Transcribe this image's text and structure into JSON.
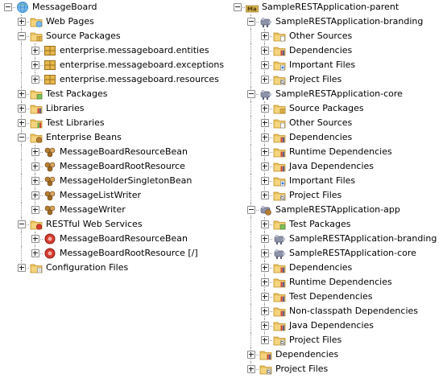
{
  "left_tree": [
    {
      "level": 0,
      "label": "MessageBoard",
      "icon": "web-project-icon",
      "toggle": "minus",
      "bar": [],
      "last": true
    },
    {
      "level": 1,
      "label": "Web Pages",
      "icon": "web-pages-folder-icon",
      "toggle": "plus",
      "bar": [],
      "last": false
    },
    {
      "level": 1,
      "label": "Source Packages",
      "icon": "source-packages-folder-icon",
      "toggle": "minus",
      "bar": [],
      "last": false
    },
    {
      "level": 2,
      "label": "enterprise.messageboard.entities",
      "icon": "package-icon",
      "toggle": "plus",
      "bar": [
        1
      ],
      "last": false
    },
    {
      "level": 2,
      "label": "enterprise.messageboard.exceptions",
      "icon": "package-icon",
      "toggle": "plus",
      "bar": [
        1
      ],
      "last": false
    },
    {
      "level": 2,
      "label": "enterprise.messageboard.resources",
      "icon": "package-icon",
      "toggle": "plus",
      "bar": [
        1
      ],
      "last": true
    },
    {
      "level": 1,
      "label": "Test Packages",
      "icon": "test-packages-folder-icon",
      "toggle": "plus",
      "bar": [],
      "last": false
    },
    {
      "level": 1,
      "label": "Libraries",
      "icon": "libraries-folder-icon",
      "toggle": "plus",
      "bar": [],
      "last": false
    },
    {
      "level": 1,
      "label": "Test Libraries",
      "icon": "test-libraries-folder-icon",
      "toggle": "plus",
      "bar": [],
      "last": false
    },
    {
      "level": 1,
      "label": "Enterprise Beans",
      "icon": "enterprise-beans-folder-icon",
      "toggle": "minus",
      "bar": [],
      "last": false
    },
    {
      "level": 2,
      "label": "MessageBoardResourceBean",
      "icon": "enterprise-bean-icon",
      "toggle": "plus",
      "bar": [
        1
      ],
      "last": false
    },
    {
      "level": 2,
      "label": "MessageBoardRootResource",
      "icon": "enterprise-bean-icon",
      "toggle": "plus",
      "bar": [
        1
      ],
      "last": false
    },
    {
      "level": 2,
      "label": "MessageHolderSingletonBean",
      "icon": "enterprise-bean-icon",
      "toggle": "plus",
      "bar": [
        1
      ],
      "last": false
    },
    {
      "level": 2,
      "label": "MessageListWriter",
      "icon": "enterprise-bean-icon",
      "toggle": "plus",
      "bar": [
        1
      ],
      "last": false
    },
    {
      "level": 2,
      "label": "MessageWriter",
      "icon": "enterprise-bean-icon",
      "toggle": "plus",
      "bar": [
        1
      ],
      "last": true
    },
    {
      "level": 1,
      "label": "RESTful Web Services",
      "icon": "restful-services-folder-icon",
      "toggle": "minus",
      "bar": [],
      "last": false
    },
    {
      "level": 2,
      "label": "MessageBoardResourceBean",
      "icon": "rest-resource-icon",
      "toggle": "plus",
      "bar": [
        1
      ],
      "last": false
    },
    {
      "level": 2,
      "label": "MessageBoardRootResource [/]",
      "icon": "rest-resource-icon",
      "toggle": "plus",
      "bar": [
        1
      ],
      "last": true
    },
    {
      "level": 1,
      "label": "Configuration Files",
      "icon": "configuration-files-folder-icon",
      "toggle": "plus",
      "bar": [],
      "last": true
    }
  ],
  "right_tree": [
    {
      "level": 0,
      "label": "SampleRESTApplication-parent",
      "icon": "maven-parent-project-icon",
      "toggle": "minus",
      "bar": [],
      "last": true
    },
    {
      "level": 1,
      "label": "SampleRESTApplication-branding",
      "icon": "maven-project-icon",
      "toggle": "minus",
      "bar": [],
      "last": false
    },
    {
      "level": 2,
      "label": "Other Sources",
      "icon": "other-sources-folder-icon",
      "toggle": "plus",
      "bar": [
        1
      ],
      "last": false
    },
    {
      "level": 2,
      "label": "Dependencies",
      "icon": "dependencies-folder-icon",
      "toggle": "plus",
      "bar": [
        1
      ],
      "last": false
    },
    {
      "level": 2,
      "label": "Important Files",
      "icon": "important-files-folder-icon",
      "toggle": "plus",
      "bar": [
        1
      ],
      "last": false
    },
    {
      "level": 2,
      "label": "Project Files",
      "icon": "project-files-folder-icon",
      "toggle": "plus",
      "bar": [
        1
      ],
      "last": true
    },
    {
      "level": 1,
      "label": "SampleRESTApplication-core",
      "icon": "maven-project-icon",
      "toggle": "minus",
      "bar": [],
      "last": false
    },
    {
      "level": 2,
      "label": "Source Packages",
      "icon": "source-packages-folder-icon",
      "toggle": "plus",
      "bar": [
        1
      ],
      "last": false
    },
    {
      "level": 2,
      "label": "Other Sources",
      "icon": "other-sources-folder-icon",
      "toggle": "plus",
      "bar": [
        1
      ],
      "last": false
    },
    {
      "level": 2,
      "label": "Dependencies",
      "icon": "dependencies-folder-icon",
      "toggle": "plus",
      "bar": [
        1
      ],
      "last": false
    },
    {
      "level": 2,
      "label": "Runtime Dependencies",
      "icon": "dependencies-folder-icon",
      "toggle": "plus",
      "bar": [
        1
      ],
      "last": false
    },
    {
      "level": 2,
      "label": "Java Dependencies",
      "icon": "dependencies-folder-icon",
      "toggle": "plus",
      "bar": [
        1
      ],
      "last": false
    },
    {
      "level": 2,
      "label": "Important Files",
      "icon": "important-files-folder-icon",
      "toggle": "plus",
      "bar": [
        1
      ],
      "last": false
    },
    {
      "level": 2,
      "label": "Project Files",
      "icon": "project-files-folder-icon",
      "toggle": "plus",
      "bar": [
        1
      ],
      "last": true
    },
    {
      "level": 1,
      "label": "SampleRESTApplication-app",
      "icon": "maven-app-project-icon",
      "toggle": "minus",
      "bar": [],
      "last": false
    },
    {
      "level": 2,
      "label": "Test Packages",
      "icon": "test-packages-folder-icon",
      "toggle": "plus",
      "bar": [
        1
      ],
      "last": false
    },
    {
      "level": 2,
      "label": "SampleRESTApplication-branding",
      "icon": "maven-module-icon",
      "toggle": "plus",
      "bar": [
        1
      ],
      "last": false
    },
    {
      "level": 2,
      "label": "SampleRESTApplication-core",
      "icon": "maven-module-icon",
      "toggle": "plus",
      "bar": [
        1
      ],
      "last": false
    },
    {
      "level": 2,
      "label": "Dependencies",
      "icon": "dependencies-folder-icon",
      "toggle": "plus",
      "bar": [
        1
      ],
      "last": false
    },
    {
      "level": 2,
      "label": "Runtime Dependencies",
      "icon": "dependencies-folder-icon",
      "toggle": "plus",
      "bar": [
        1
      ],
      "last": false
    },
    {
      "level": 2,
      "label": "Test Dependencies",
      "icon": "dependencies-folder-icon",
      "toggle": "plus",
      "bar": [
        1
      ],
      "last": false
    },
    {
      "level": 2,
      "label": "Non-classpath Dependencies",
      "icon": "dependencies-folder-icon",
      "toggle": "plus",
      "bar": [
        1
      ],
      "last": false
    },
    {
      "level": 2,
      "label": "Java Dependencies",
      "icon": "dependencies-folder-icon",
      "toggle": "plus",
      "bar": [
        1
      ],
      "last": false
    },
    {
      "level": 2,
      "label": "Project Files",
      "icon": "project-files-folder-icon",
      "toggle": "plus",
      "bar": [
        1
      ],
      "last": true
    },
    {
      "level": 1,
      "label": "Dependencies",
      "icon": "dependencies-folder-icon",
      "toggle": "plus",
      "bar": [],
      "last": false
    },
    {
      "level": 1,
      "label": "Project Files",
      "icon": "project-files-folder-icon",
      "toggle": "plus",
      "bar": [],
      "last": true
    }
  ],
  "colors": {
    "folder": "#e8c15c",
    "folder_dark": "#c08f27",
    "package": "#e6b84e",
    "maven_gray": "#8d93a8",
    "bean": "#b77f33",
    "rest": "#d63b2f",
    "globe": "#3a8fd4"
  }
}
